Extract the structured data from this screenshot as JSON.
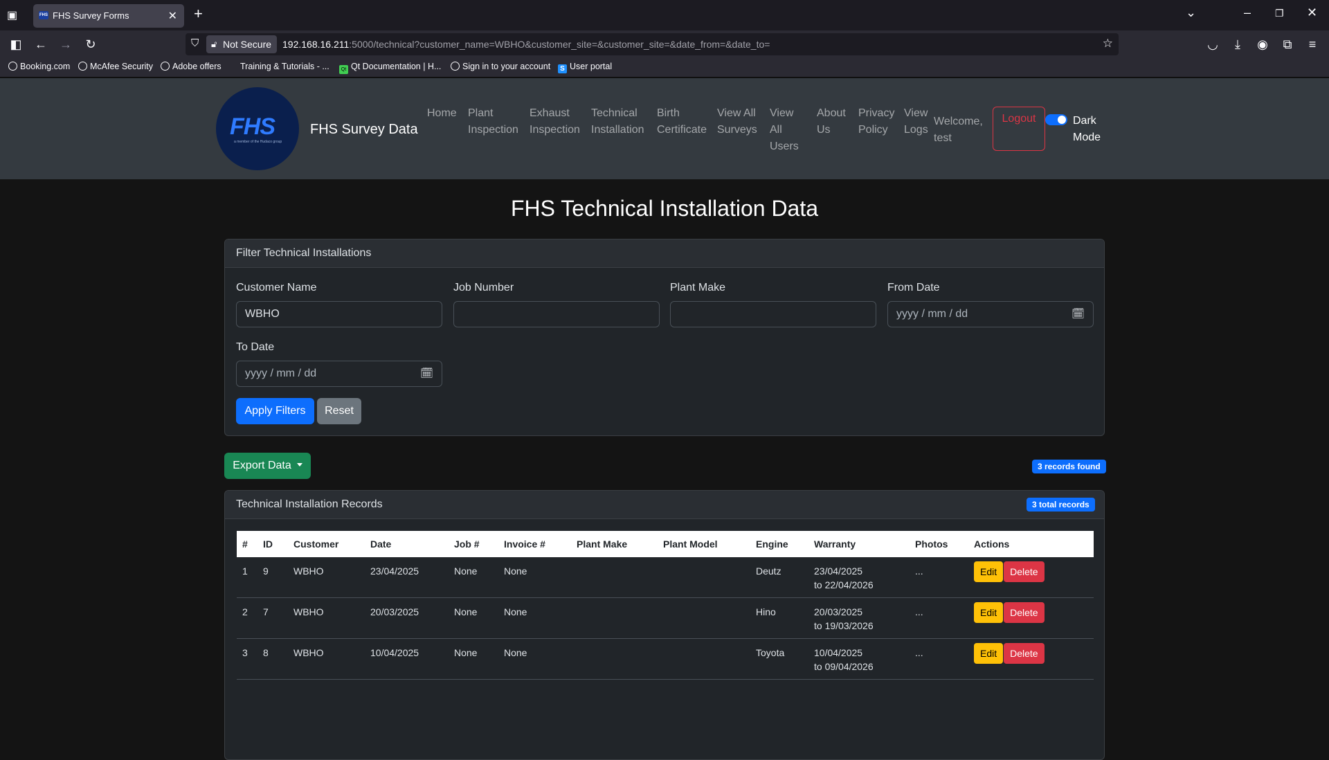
{
  "browser": {
    "tab_title": "FHS Survey Forms",
    "not_secure": "Not Secure",
    "url_host": "192.168.16.211",
    "url_rest": ":5000/technical?customer_name=WBHO&customer_site=&customer_site=&date_from=&date_to=",
    "bookmarks": [
      "Booking.com",
      "McAfee Security",
      "Adobe offers",
      "Training & Tutorials - ...",
      "Qt Documentation | H...",
      "Sign in to your account",
      "User portal"
    ]
  },
  "nav": {
    "logo_text": "FHS",
    "logo_sub": "a member of the Hudaco group",
    "brand": "FHS Survey Data",
    "links": {
      "home": "Home",
      "plant_1": "Plant",
      "plant_2": "Inspection",
      "exhaust_1": "Exhaust",
      "exhaust_2": "Inspection",
      "tech_1": "Technical",
      "tech_2": "Installation",
      "birth_1": "Birth",
      "birth_2": "Certificate",
      "surveys_1": "View All",
      "surveys_2": "Surveys",
      "users_1": "View",
      "users_2": "All",
      "users_3": "Users",
      "about_1": "About",
      "about_2": "Us",
      "privacy_1": "Privacy",
      "privacy_2": "Policy",
      "logs_1": "View",
      "logs_2": "Logs"
    },
    "welcome_1": "Welcome,",
    "welcome_2": "test",
    "logout": "Logout",
    "dark_1": "Dark",
    "dark_2": "Mode"
  },
  "page_title": "FHS Technical Installation Data",
  "filter": {
    "header": "Filter Technical Installations",
    "customer_label": "Customer Name",
    "customer_value": "WBHO",
    "job_label": "Job Number",
    "job_value": "",
    "plant_label": "Plant Make",
    "plant_value": "",
    "from_label": "From Date",
    "from_placeholder": "yyyy / mm / dd",
    "to_label": "To Date",
    "to_placeholder": "yyyy / mm / dd",
    "apply": "Apply Filters",
    "reset": "Reset"
  },
  "export_label": "Export Data",
  "records_found": "3 records found",
  "records": {
    "header": "Technical Installation Records",
    "total_badge": "3 total records",
    "columns": [
      "#",
      "ID",
      "Customer",
      "Date",
      "Job #",
      "Invoice #",
      "Plant Make",
      "Plant Model",
      "Engine",
      "Warranty",
      "Photos",
      "Actions"
    ],
    "rows": [
      {
        "n": "1",
        "id": "9",
        "customer": "WBHO",
        "date": "23/04/2025",
        "job": "None",
        "invoice": "None",
        "make": "",
        "model": "",
        "engine": "Deutz",
        "w1": "23/04/2025",
        "w2": "to 22/04/2026",
        "photos": "..."
      },
      {
        "n": "2",
        "id": "7",
        "customer": "WBHO",
        "date": "20/03/2025",
        "job": "None",
        "invoice": "None",
        "make": "",
        "model": "",
        "engine": "Hino",
        "w1": "20/03/2025",
        "w2": "to 19/03/2026",
        "photos": "..."
      },
      {
        "n": "3",
        "id": "8",
        "customer": "WBHO",
        "date": "10/04/2025",
        "job": "None",
        "invoice": "None",
        "make": "",
        "model": "",
        "engine": "Toyota",
        "w1": "10/04/2025",
        "w2": "to 09/04/2026",
        "photos": "..."
      }
    ],
    "edit": "Edit",
    "delete": "Delete"
  }
}
